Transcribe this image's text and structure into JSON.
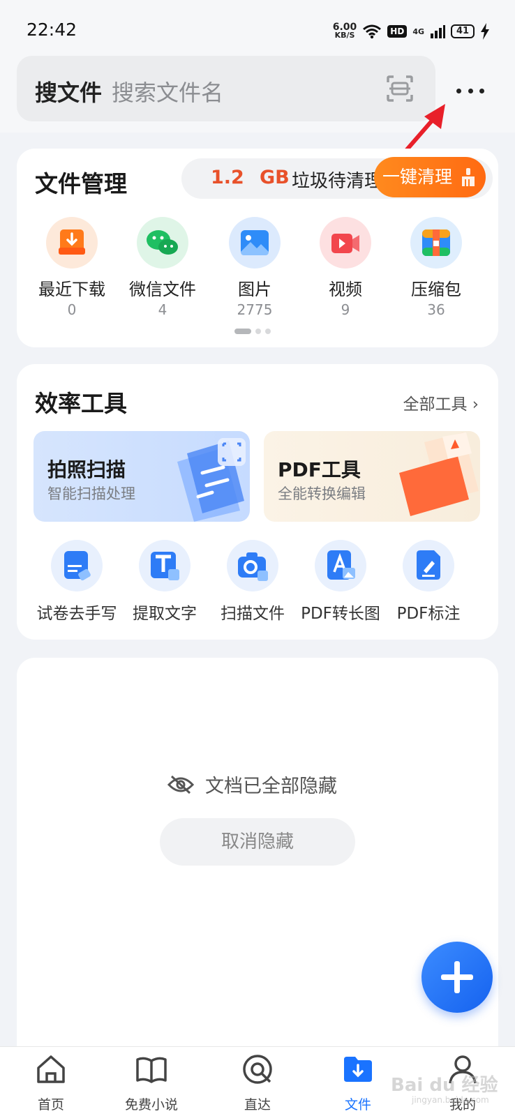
{
  "status": {
    "time": "22:42",
    "net_speed_value": "6.00",
    "net_speed_unit": "KB/S",
    "hd": "HD",
    "network": "4G",
    "battery": "41"
  },
  "search": {
    "label": "搜文件",
    "placeholder": "搜索文件名",
    "scan_icon": "scan-icon",
    "more_icon": "more-dots-icon"
  },
  "file_management": {
    "title": "文件管理",
    "junk_amount": "1.2",
    "junk_unit": "GB",
    "junk_text": "垃圾待清理",
    "clean_button": "一键清理",
    "categories": [
      {
        "name": "最近下载",
        "count": "0",
        "icon": "download-icon",
        "color": "#ff7a1a"
      },
      {
        "name": "微信文件",
        "count": "4",
        "icon": "wechat-icon",
        "color": "#1fbf62"
      },
      {
        "name": "图片",
        "count": "2775",
        "icon": "image-icon",
        "color": "#2e8cf8"
      },
      {
        "name": "视频",
        "count": "9",
        "icon": "video-icon",
        "color": "#f2464d"
      },
      {
        "name": "压缩包",
        "count": "36",
        "icon": "zip-icon",
        "color": "#f7a21d"
      }
    ]
  },
  "tools": {
    "title": "效率工具",
    "all_tools": "全部工具",
    "cards": [
      {
        "title": "拍照扫描",
        "subtitle": "智能扫描处理"
      },
      {
        "title": "PDF工具",
        "subtitle": "全能转换编辑"
      }
    ],
    "items": [
      {
        "name": "试卷去手写",
        "icon": "exam-erase-icon"
      },
      {
        "name": "提取文字",
        "icon": "text-extract-icon"
      },
      {
        "name": "扫描文件",
        "icon": "scan-file-icon"
      },
      {
        "name": "PDF转长图",
        "icon": "pdf-to-image-icon"
      },
      {
        "name": "PDF标注",
        "icon": "pdf-annotate-icon"
      }
    ]
  },
  "documents": {
    "hidden_message": "文档已全部隐藏",
    "unhide_button": "取消隐藏"
  },
  "tabbar": {
    "tabs": [
      {
        "label": "首页",
        "icon": "home-icon"
      },
      {
        "label": "免费小说",
        "icon": "book-icon"
      },
      {
        "label": "直达",
        "icon": "direct-icon"
      },
      {
        "label": "文件",
        "icon": "file-icon",
        "active": true
      },
      {
        "label": "我的",
        "icon": "profile-icon"
      }
    ]
  },
  "colors": {
    "accent": "#1a73ff",
    "junk_highlight": "#e8512a",
    "clean_button": "#ff7a1a",
    "annotation_arrow": "#e8202a"
  },
  "watermark": {
    "text": "Bai du 经验",
    "sub": "jingyan.baidu.com"
  }
}
